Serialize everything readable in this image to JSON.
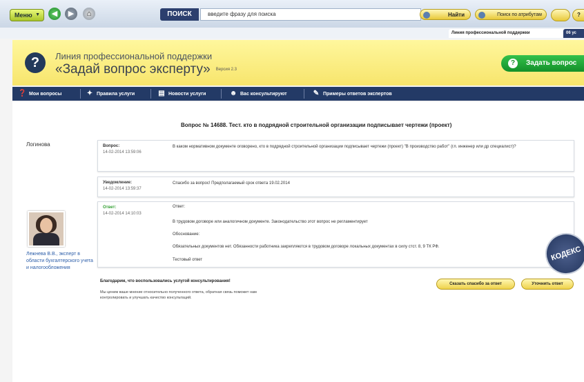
{
  "toolbar": {
    "menu_label": "Меню",
    "search_tab": "ПОИСК",
    "search_placeholder": "введите фразу для поиска",
    "find_label": "Найти",
    "attr_search_label": "Поиск по атрибутам",
    "help_label": "?"
  },
  "tabs": [
    {
      "label": "Линия профессиональной поддержки",
      "active": true
    },
    {
      "label": "06 ус"
    }
  ],
  "banner": {
    "line1": "Линия профессиональной поддержки",
    "line2": "«Задай вопрос эксперту»",
    "version": "Версия 2.3",
    "ask_button": "Задать вопрос"
  },
  "nav": {
    "items": [
      {
        "label": "Мои вопросы",
        "icon": "question-icon"
      },
      {
        "label": "Правила услуги",
        "icon": "pin-icon"
      },
      {
        "label": "Новости услуги",
        "icon": "news-icon"
      },
      {
        "label": "Вас консультируют",
        "icon": "people-icon"
      },
      {
        "label": "Примеры ответов экспертов",
        "icon": "edit-icon"
      }
    ]
  },
  "question": {
    "title": "Вопрос № 14688. Тест. кто в подрядной строительной организации подписывает чертежи (проект)",
    "user": "Логинова",
    "label": "Вопрос:",
    "date": "14-02-2014 13:59:06",
    "text": "В каком нормативном документе оговорено, кто в подрядной строительной организации подписывает чертежи (проект) \"В производство работ\" (гл. инженер или др специалист)?"
  },
  "notice": {
    "label": "Уведомление:",
    "date": "14-02-2014 13:59:37",
    "text": "Спасибо за вопрос! Предполагаемый срок ответа 19.02.2014"
  },
  "answer": {
    "label": "Ответ:",
    "date": "14-02-2014 14:10:03",
    "lines": [
      "Ответ:",
      "В трудовом договоре или аналогичном документе. Законодательство этот вопрос не регламентирует",
      "Обоснование:",
      "Обязательных документов нет. Обязанности работника закрепляются в трудовом договоре локальных документах в силу стст. 8, 9 ТК РФ.",
      "Тестовый ответ"
    ]
  },
  "expert": {
    "text": "Лежнева В.В., эксперт в области бухгалтерского учета и налогообложения"
  },
  "seal": {
    "text": "КОДЕКС"
  },
  "feedback": {
    "title": "Благодарим, что воспользовались услугой консультирования!",
    "text": "Мы ценим ваше мнение относительно полученного ответа, обратная связь поможет нам контролировать и улучшать качество консультаций.",
    "thank_button": "Сказать спасибо за ответ",
    "clarify_button": "Уточнить ответ"
  }
}
